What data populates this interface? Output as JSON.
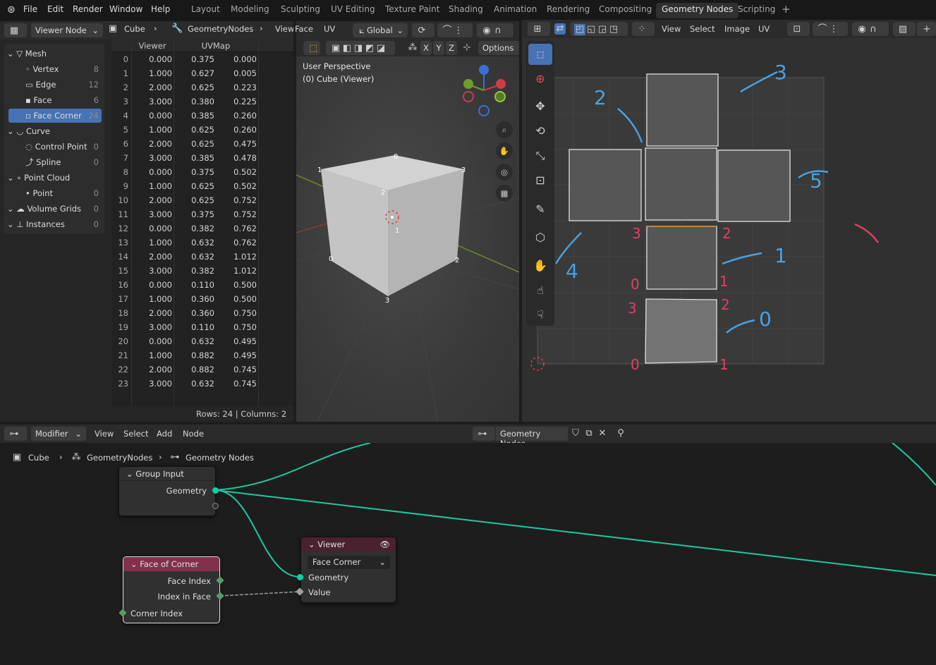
{
  "menus": [
    "File",
    "Edit",
    "Render",
    "Window",
    "Help"
  ],
  "workspaces": [
    "Layout",
    "Modeling",
    "Sculpting",
    "UV Editing",
    "Texture Paint",
    "Shading",
    "Animation",
    "Rendering",
    "Compositing",
    "Geometry Nodes",
    "Scripting"
  ],
  "active_workspace": "Geometry Nodes",
  "ss_header": {
    "viewer_node": "Viewer Node",
    "object": "Cube",
    "modifier": "GeometryNodes",
    "viewer": "Viewer"
  },
  "tree": [
    {
      "label": "Mesh",
      "count": "",
      "indent": 0
    },
    {
      "label": "Vertex",
      "count": "8",
      "indent": 1
    },
    {
      "label": "Edge",
      "count": "12",
      "indent": 1
    },
    {
      "label": "Face",
      "count": "6",
      "indent": 1
    },
    {
      "label": "Face Corner",
      "count": "24",
      "indent": 1
    },
    {
      "label": "Curve",
      "count": "",
      "indent": 0
    },
    {
      "label": "Control Point",
      "count": "0",
      "indent": 1
    },
    {
      "label": "Spline",
      "count": "0",
      "indent": 1
    },
    {
      "label": "Point Cloud",
      "count": "",
      "indent": 0
    },
    {
      "label": "Point",
      "count": "0",
      "indent": 1
    },
    {
      "label": "Volume Grids",
      "count": "0",
      "indent": 0
    },
    {
      "label": "Instances",
      "count": "0",
      "indent": 0
    }
  ],
  "table": {
    "headers": [
      "Viewer",
      "UVMap"
    ],
    "rows": [
      [
        0,
        "0.000",
        "0.375",
        "0.000"
      ],
      [
        1,
        "1.000",
        "0.627",
        "0.005"
      ],
      [
        2,
        "2.000",
        "0.625",
        "0.223"
      ],
      [
        3,
        "3.000",
        "0.380",
        "0.225"
      ],
      [
        4,
        "0.000",
        "0.385",
        "0.260"
      ],
      [
        5,
        "1.000",
        "0.625",
        "0.260"
      ],
      [
        6,
        "2.000",
        "0.625",
        "0.475"
      ],
      [
        7,
        "3.000",
        "0.385",
        "0.478"
      ],
      [
        8,
        "0.000",
        "0.375",
        "0.502"
      ],
      [
        9,
        "1.000",
        "0.625",
        "0.502"
      ],
      [
        10,
        "2.000",
        "0.625",
        "0.752"
      ],
      [
        11,
        "3.000",
        "0.375",
        "0.752"
      ],
      [
        12,
        "0.000",
        "0.382",
        "0.762"
      ],
      [
        13,
        "1.000",
        "0.632",
        "0.762"
      ],
      [
        14,
        "2.000",
        "0.632",
        "1.012"
      ],
      [
        15,
        "3.000",
        "0.382",
        "1.012"
      ],
      [
        16,
        "0.000",
        "0.110",
        "0.500"
      ],
      [
        17,
        "1.000",
        "0.360",
        "0.500"
      ],
      [
        18,
        "2.000",
        "0.360",
        "0.750"
      ],
      [
        19,
        "3.000",
        "0.110",
        "0.750"
      ],
      [
        20,
        "0.000",
        "0.632",
        "0.495"
      ],
      [
        21,
        "1.000",
        "0.882",
        "0.495"
      ],
      [
        22,
        "2.000",
        "0.882",
        "0.745"
      ],
      [
        23,
        "3.000",
        "0.632",
        "0.745"
      ]
    ],
    "footer": "Rows: 24   |   Columns: 2"
  },
  "v3d": {
    "face": "Face",
    "uv": "UV",
    "orientation": "Global",
    "options": "Options",
    "perspective": "User Perspective",
    "object": "(0) Cube (Viewer)",
    "axes": [
      "X",
      "Y",
      "Z"
    ]
  },
  "uv_header": {
    "view": "View",
    "select": "Select",
    "image": "Image",
    "uv": "UV"
  },
  "uv_annotations_blue": [
    "3",
    "2",
    "5",
    "4",
    "1",
    "0"
  ],
  "uv_annotations_red": [
    "3",
    "2",
    "0",
    "1",
    "3",
    "2",
    "0",
    "1"
  ],
  "cube_corner_labels": [
    "0",
    "1",
    "3",
    "2",
    "1",
    "0",
    "2",
    "3"
  ],
  "node_header": {
    "editor": "Modifier",
    "view": "View",
    "select": "Select",
    "add": "Add",
    "node": "Node",
    "tree": "Geometry Nodes"
  },
  "node_breadcrumb": {
    "object": "Cube",
    "modifier": "GeometryNodes",
    "tree": "Geometry Nodes"
  },
  "nodes": {
    "group_input": {
      "title": "Group Input",
      "out": "Geometry"
    },
    "viewer": {
      "title": "Viewer",
      "domain": "Face Corner",
      "in1": "Geometry",
      "in2": "Value"
    },
    "face_of_corner": {
      "title": "Face of Corner",
      "out1": "Face Index",
      "out2": "Index in Face",
      "in": "Corner Index"
    }
  },
  "colors": {
    "accent": "#4772b3",
    "geometry_socket": "#00d6a3",
    "viewer_header": "#4b2130",
    "foc_header": "#83314a"
  }
}
